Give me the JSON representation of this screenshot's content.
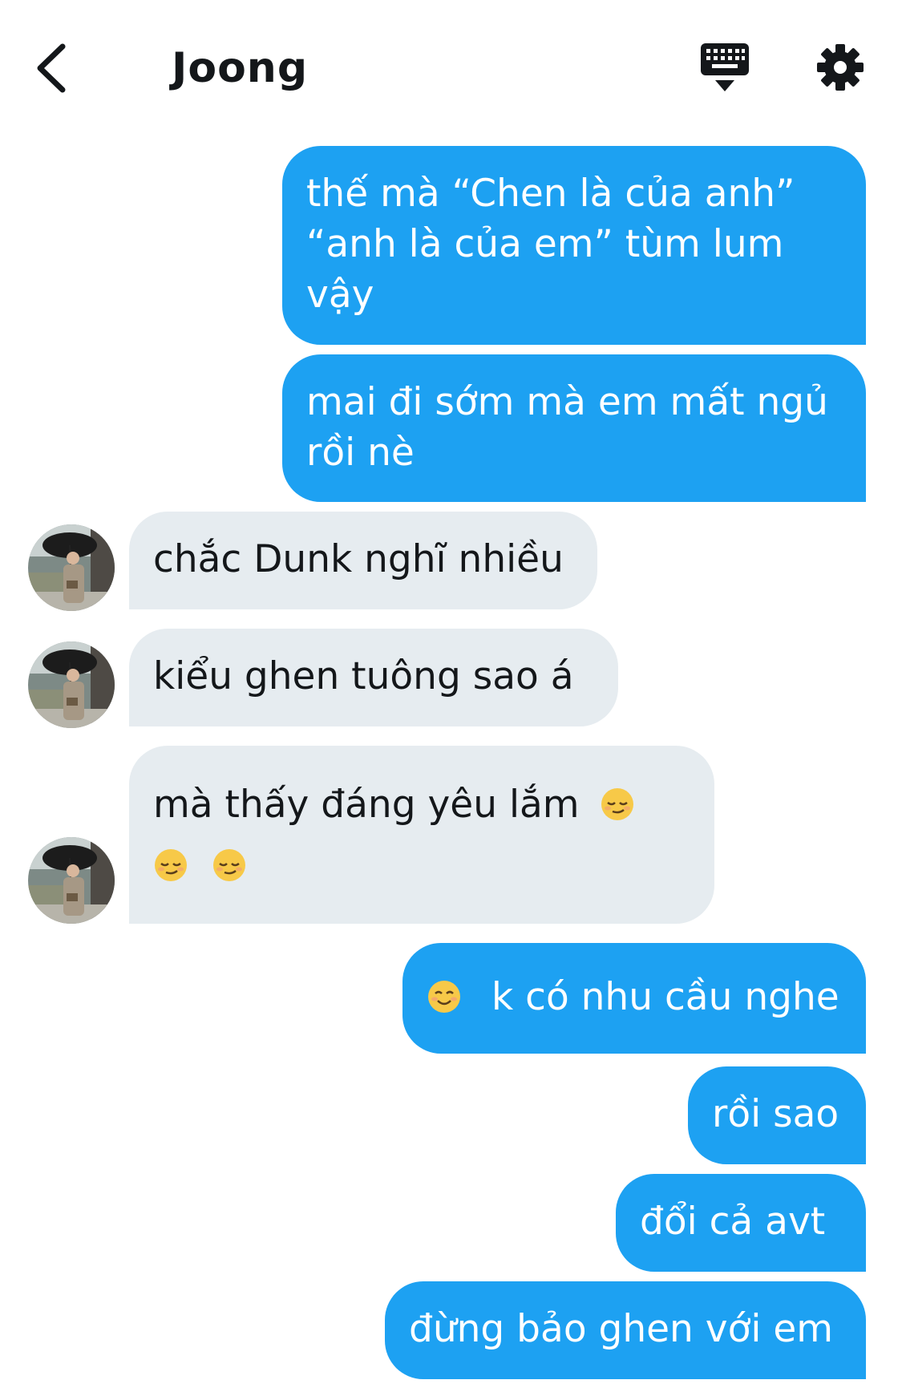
{
  "header": {
    "title": "Joong"
  },
  "icons": {
    "back": "chevron-left-icon",
    "keyboard": "keyboard-icon",
    "settings": "gear-icon",
    "emoji_pensive": "relieved-face-emoji",
    "emoji_smile": "smiling-face-emoji"
  },
  "colors": {
    "outgoing_bubble": "#1da1f2",
    "incoming_bubble": "#e6ecf0"
  },
  "messages": [
    {
      "direction": "outgoing",
      "lines": [
        "thế mà “Chen là của anh”",
        "“anh là của em” tùm lum",
        "vậy"
      ]
    },
    {
      "direction": "outgoing",
      "lines": [
        "mai đi sớm mà em mất ngủ",
        "rồi nè"
      ]
    },
    {
      "direction": "incoming",
      "lines": [
        "chắc Dunk nghĩ nhiều"
      ]
    },
    {
      "direction": "incoming",
      "lines": [
        "kiểu ghen tuông sao á"
      ]
    },
    {
      "direction": "incoming",
      "lines": [
        "mà thấy đáng yêu lắm"
      ]
    },
    {
      "direction": "outgoing",
      "lines": [
        "k có nhu cầu nghe"
      ]
    },
    {
      "direction": "outgoing",
      "lines": [
        "rồi sao"
      ]
    },
    {
      "direction": "outgoing",
      "lines": [
        "đổi cả avt"
      ]
    },
    {
      "direction": "outgoing",
      "lines": [
        "đừng bảo ghen với em"
      ]
    }
  ]
}
